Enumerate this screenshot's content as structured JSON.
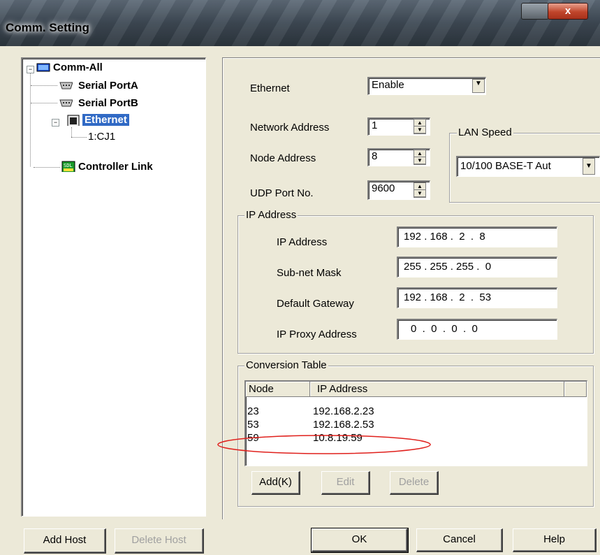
{
  "window": {
    "title": "Comm. Setting",
    "close_glyph": "x"
  },
  "tree": {
    "root": "Comm-All",
    "items": [
      "Serial PortA",
      "Serial PortB",
      "Ethernet",
      "1:CJ1",
      "Controller Link"
    ],
    "selected": "Ethernet",
    "expander_glyph": "−"
  },
  "ethernet": {
    "label": "Ethernet",
    "value": "Enable"
  },
  "network_address": {
    "label": "Network Address",
    "value": "1"
  },
  "node_address": {
    "label": "Node Address",
    "value": "8"
  },
  "udp_port": {
    "label": "UDP Port No.",
    "value": "9600"
  },
  "lan_speed": {
    "title": "LAN Speed",
    "value": "10/100 BASE-T Aut"
  },
  "ip_group": {
    "title": "IP Address",
    "ip_address": {
      "label": "IP Address",
      "value": "192 . 168 .  2  .  8"
    },
    "subnet": {
      "label": "Sub-net Mask",
      "value": "255 . 255 . 255 .  0"
    },
    "gateway": {
      "label": "Default Gateway",
      "value": "192 . 168 .  2  .  53"
    },
    "proxy": {
      "label": "IP Proxy Address",
      "value": "0  .  0  .  0  .  0"
    }
  },
  "conversion": {
    "title": "Conversion Table",
    "columns": [
      "Node",
      "IP Address"
    ],
    "rows": [
      {
        "node": "23",
        "ip": "192.168.2.23"
      },
      {
        "node": "53",
        "ip": "192.168.2.53"
      },
      {
        "node": "59",
        "ip": "10.8.19.59"
      }
    ],
    "add": "Add(K)",
    "edit": "Edit",
    "delete": "Delete"
  },
  "buttons": {
    "add_host": "Add Host",
    "delete_host": "Delete Host",
    "ok": "OK",
    "cancel": "Cancel",
    "help": "Help"
  },
  "annotation_color": "#e0201c"
}
